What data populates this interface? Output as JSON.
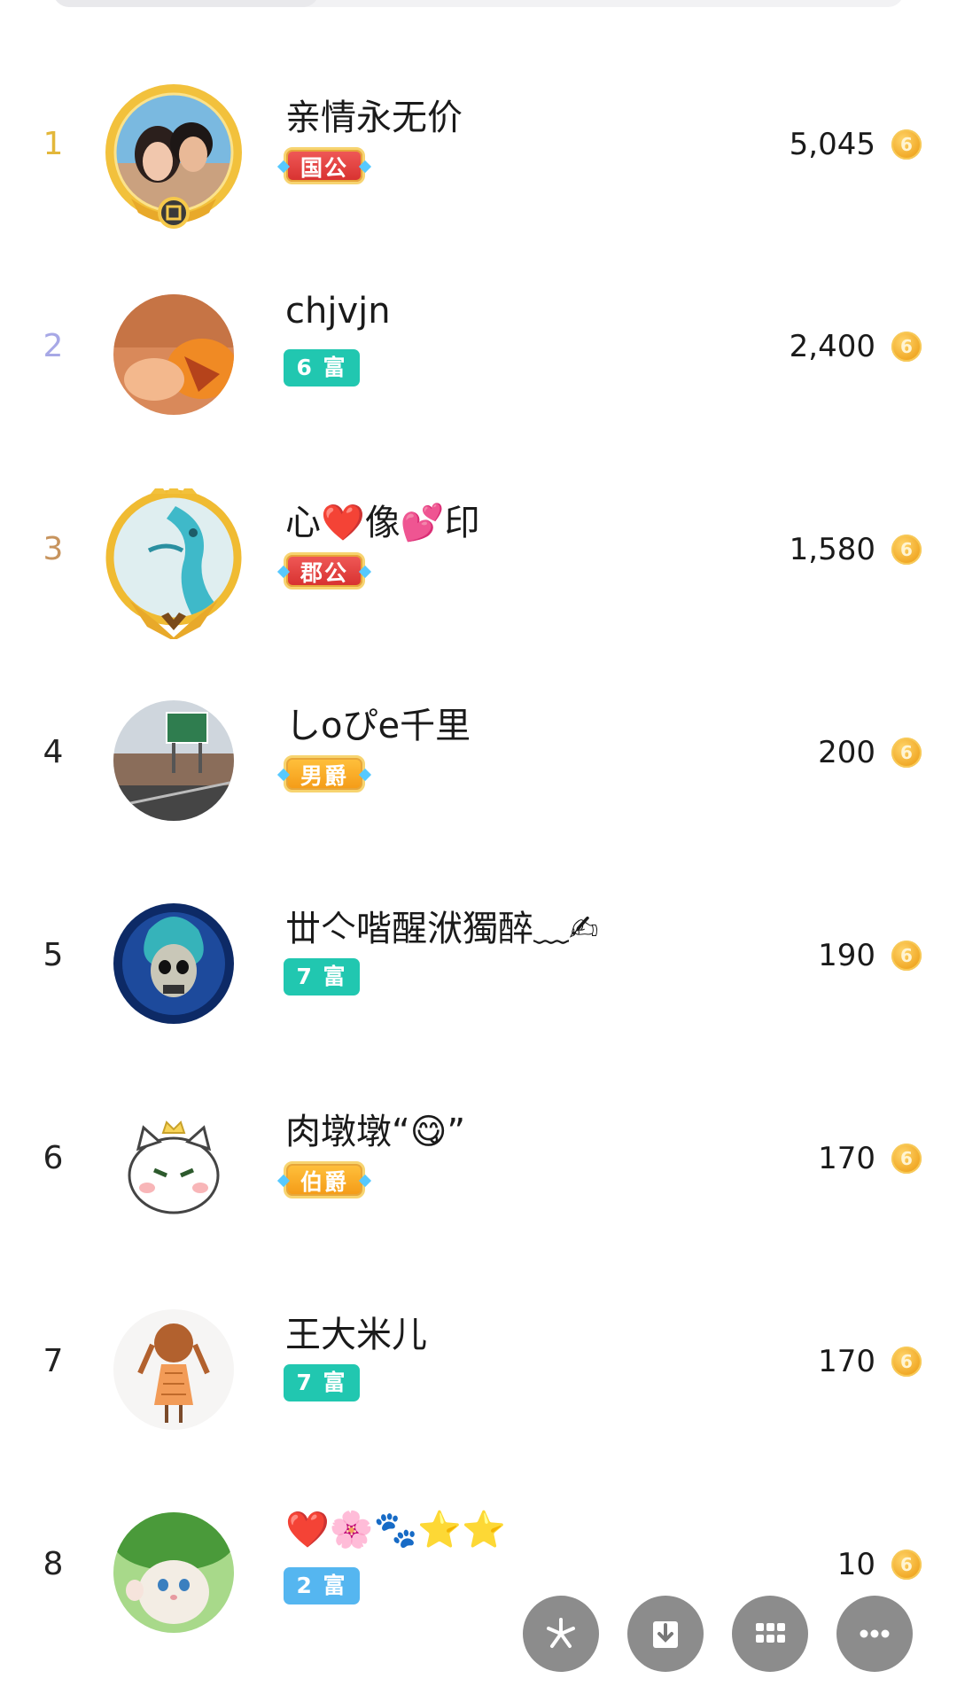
{
  "rows": [
    {
      "rank": "1",
      "name": "亲情永无价",
      "badge": "国公",
      "score": "5,045"
    },
    {
      "rank": "2",
      "name": "chjvjn",
      "badge": "6 富",
      "score": "2,400"
    },
    {
      "rank": "3",
      "name": "心❤️像💕印",
      "badge": "郡公",
      "score": "1,580"
    },
    {
      "rank": "4",
      "name": "しoぴe千里",
      "badge": "男爵",
      "score": "200"
    },
    {
      "rank": "5",
      "name": "丗亽喈醒洑獨醉﹏✍",
      "badge": "7 富",
      "score": "190"
    },
    {
      "rank": "6",
      "name": "肉墩墩“😋”",
      "badge": "伯爵",
      "score": "170"
    },
    {
      "rank": "7",
      "name": "王大米儿",
      "badge": "7 富",
      "score": "170"
    },
    {
      "rank": "8",
      "name": "❤️🌸🐾⭐⭐",
      "badge": "2 富",
      "score": "10"
    }
  ],
  "coin_glyph": "6",
  "icons": {
    "coin": "coin-icon",
    "fab_1": "sparkle-icon",
    "fab_2": "download-icon",
    "fab_3": "grid-icon",
    "fab_4": "more-icon"
  },
  "colors": {
    "rank1": "#e3b73a",
    "rank2": "#a7a8e6",
    "rank3": "#c7945e",
    "wealth_badge": "#21c7b0",
    "wealth_badge_low": "#55b6f0",
    "noble_red": "#d7302f",
    "noble_orange": "#f49a16",
    "coin": "#f0a623"
  }
}
